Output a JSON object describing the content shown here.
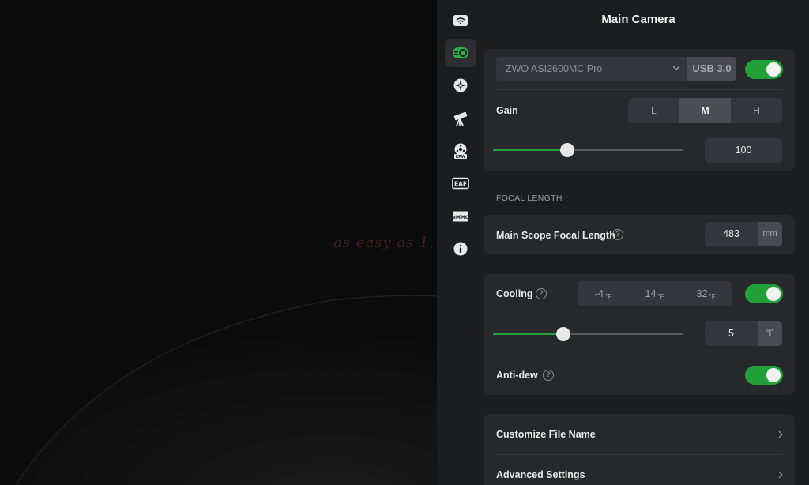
{
  "background": {
    "tagline_start": "as ",
    "tagline_red": "easy",
    "tagline_end": " as 1,"
  },
  "rail": {
    "items": [
      {
        "name": "wifi-icon",
        "active": false
      },
      {
        "name": "camera-icon",
        "active": true
      },
      {
        "name": "guide-icon",
        "active": false
      },
      {
        "name": "telescope-icon",
        "active": false
      },
      {
        "name": "epw-icon",
        "active": false,
        "badge": "EPW"
      },
      {
        "name": "eaf-icon",
        "active": false,
        "badge": "EAF"
      },
      {
        "name": "emmc-icon",
        "active": false,
        "badge": "eMMC"
      },
      {
        "name": "info-icon",
        "active": false
      }
    ]
  },
  "header": {
    "title": "Main Camera"
  },
  "camera": {
    "model": "ZWO ASI2600MC Pro",
    "connection": "USB 3.0",
    "enabled": true
  },
  "gain": {
    "label": "Gain",
    "options": [
      "L",
      "M",
      "H"
    ],
    "selected": "M",
    "value": "100",
    "slider_fraction": 0.39
  },
  "focal": {
    "section": "FOCAL LENGTH",
    "label": "Main Scope Focal Length",
    "value": "483",
    "unit": "mm"
  },
  "cooling": {
    "label": "Cooling",
    "presets": [
      {
        "value": "-4",
        "unit": "°F"
      },
      {
        "value": "14",
        "unit": "°F"
      },
      {
        "value": "32",
        "unit": "°F"
      }
    ],
    "enabled": true,
    "value": "5",
    "unit": "°F",
    "slider_fraction": 0.37
  },
  "antidew": {
    "label": "Anti-dew",
    "enabled": true
  },
  "links": {
    "customize": "Customize File Name",
    "advanced": "Advanced Settings"
  },
  "colors": {
    "accent": "#21a03a",
    "panel": "#1c1d1f",
    "card": "#26282b"
  }
}
